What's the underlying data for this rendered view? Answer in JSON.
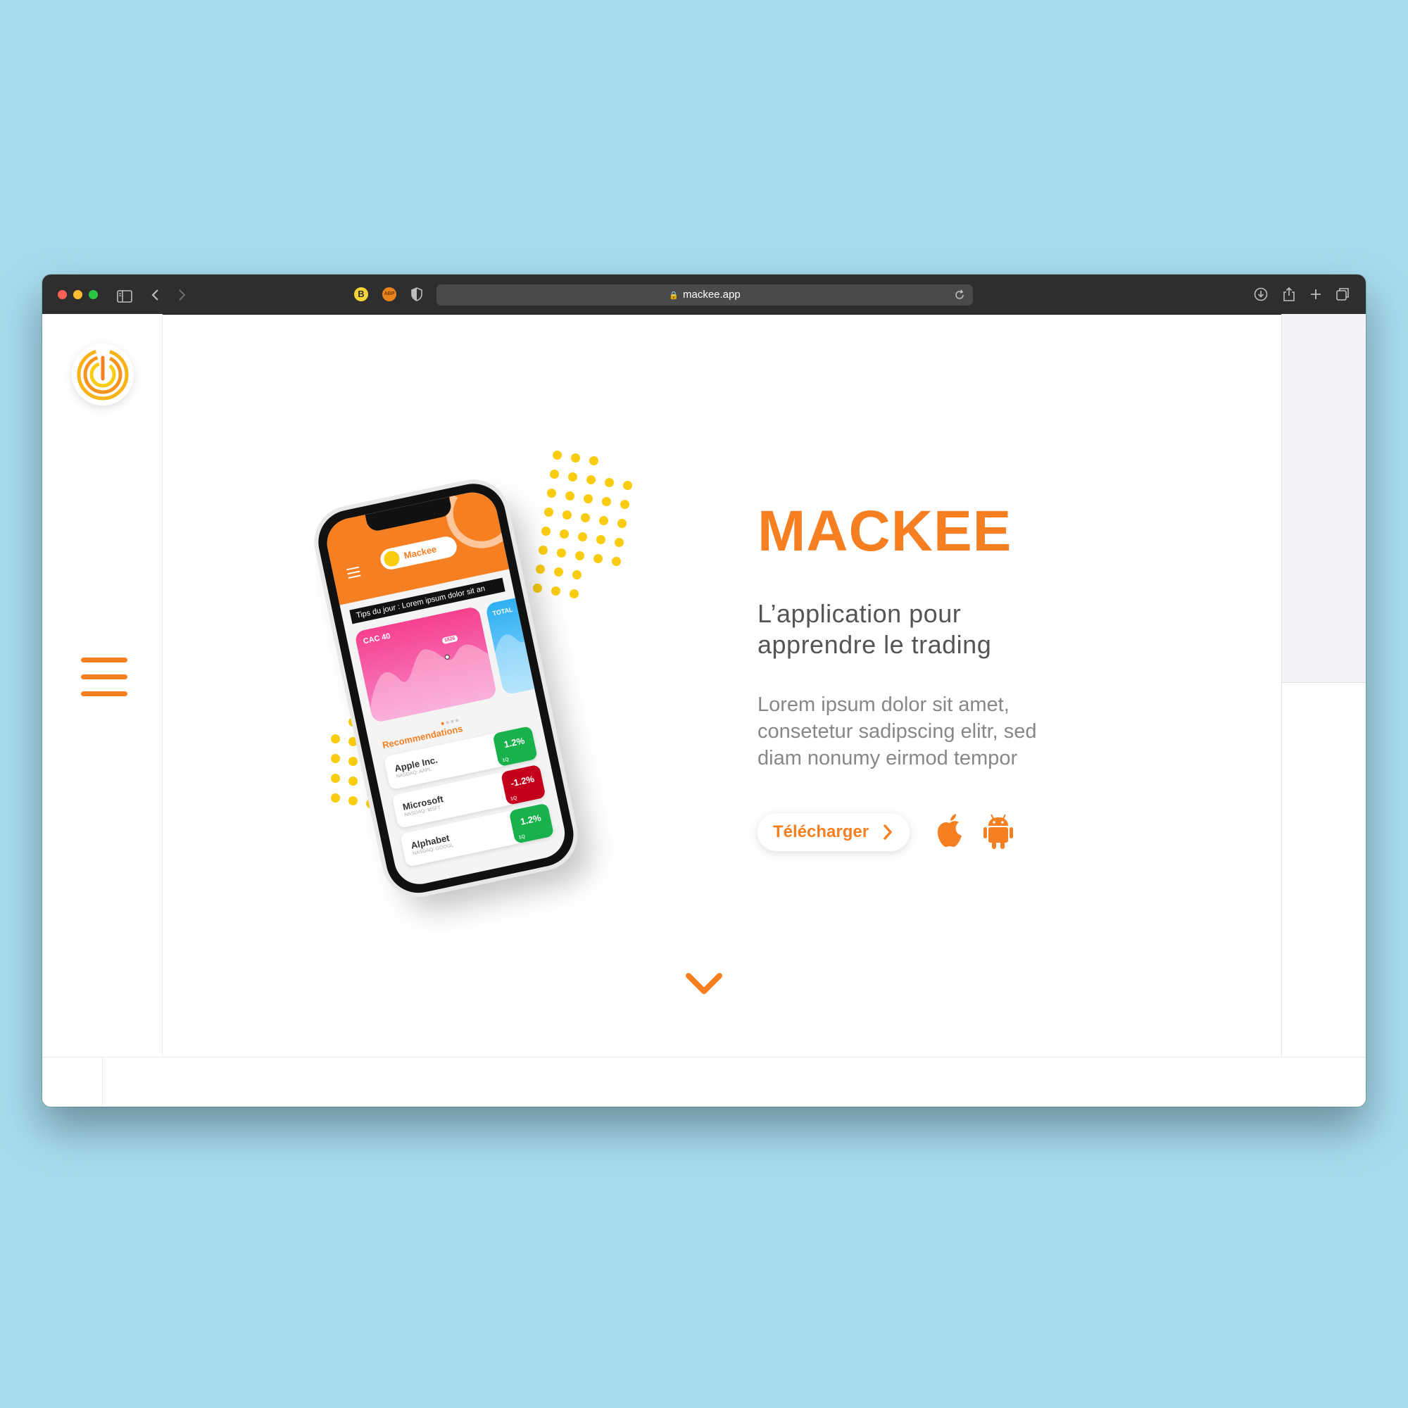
{
  "browser": {
    "url": "mackee.app",
    "extensions": {
      "b_badge": "B",
      "abp_badge": "ABP"
    }
  },
  "hero": {
    "title": "MACKEE",
    "subtitle": "L’application pour apprendre le trading",
    "description": "Lorem ipsum dolor sit amet, consetetur sadipscing elitr, sed diam nonumy eirmod tempor",
    "download_label": "Télécharger"
  },
  "phone_app": {
    "brand": "Mackee",
    "tip": "Tips du jour : Lorem ipsum dolor sit an",
    "cards": [
      {
        "label": "CAC 40",
        "tag": "1826"
      },
      {
        "label": "TOTAL"
      }
    ],
    "recommendations_title": "Recommendations",
    "stocks": [
      {
        "name": "Apple Inc.",
        "ticker": "NASDAQ: AAPL",
        "change": "1.2%",
        "period": "1Q",
        "direction": "up"
      },
      {
        "name": "Microsoft",
        "ticker": "NASDAQ: MSFT",
        "change": "-1.2%",
        "period": "1Q",
        "direction": "down"
      },
      {
        "name": "Alphabet",
        "ticker": "NASDAQ: GOOGL",
        "change": "1.2%",
        "period": "1Q",
        "direction": "up"
      }
    ]
  },
  "colors": {
    "accent": "#f57f21",
    "dots": "#f9cc12",
    "page_bg": "#a6dbee",
    "positive": "#18b14c",
    "negative": "#c4001c"
  },
  "icons": {
    "logo": "mackee-logo-icon",
    "menu": "hamburger-menu-icon",
    "apple": "apple-icon",
    "android": "android-icon",
    "scroll": "chevron-down-icon"
  }
}
